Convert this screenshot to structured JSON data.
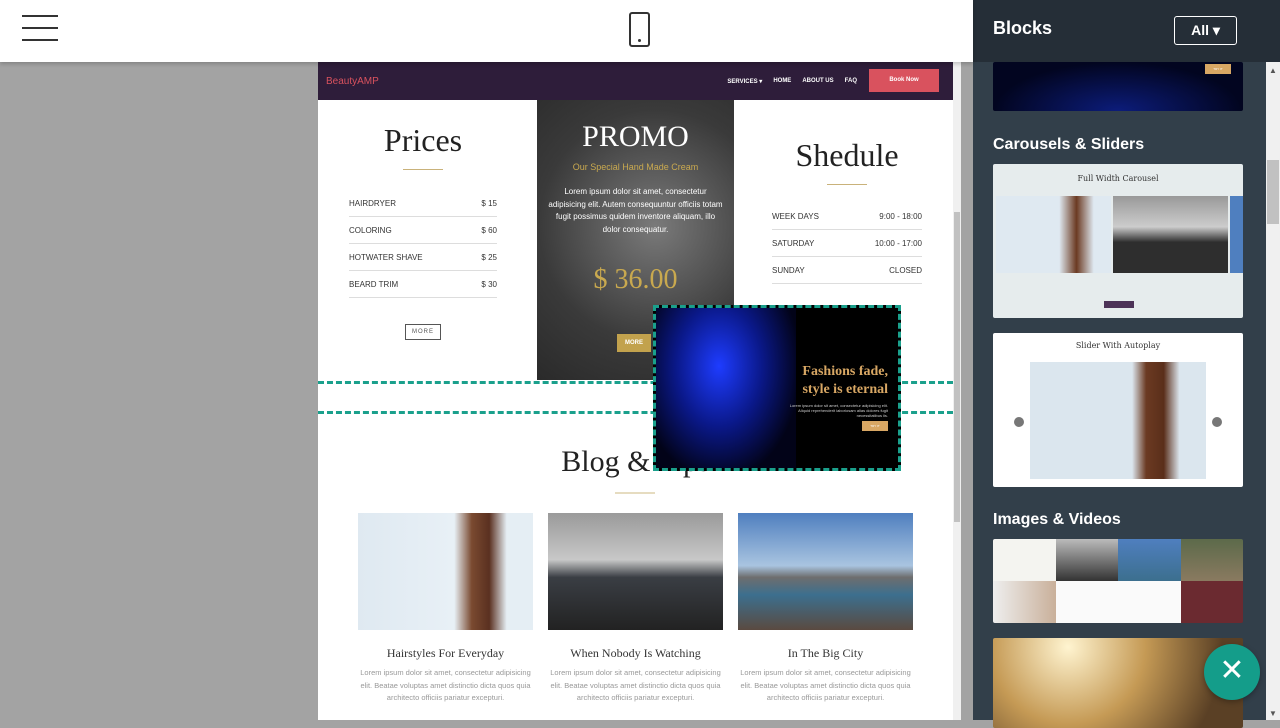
{
  "topbar": {
    "menu_icon": "hamburger-icon",
    "device_icon": "mobile-phone-icon"
  },
  "site": {
    "brand": "BeautyAMP",
    "nav": [
      "SERVICES ▾",
      "HOME",
      "ABOUT US",
      "FAQ"
    ],
    "book": "Book Now",
    "prices": {
      "title": "Prices",
      "items": [
        {
          "name": "HAIRDRYER",
          "price": "$ 15"
        },
        {
          "name": "COLORING",
          "price": "$ 60"
        },
        {
          "name": "HOTWATER SHAVE",
          "price": "$ 25"
        },
        {
          "name": "BEARD TRIM",
          "price": "$ 30"
        }
      ],
      "more": "MORE"
    },
    "promo": {
      "title": "PROMO",
      "subtitle": "Our Special Hand Made Cream",
      "body": "Lorem ipsum dolor sit amet, consectetur adipisicing elit. Autem consequuntur officiis totam fugit possimus quidem inventore aliquam, illo dolor consequatur.",
      "price": "$ 36.00",
      "more": "MORE"
    },
    "schedule": {
      "title": "Shedule",
      "items": [
        {
          "day": "WEEK DAYS",
          "time": "9:00 - 18:00"
        },
        {
          "day": "SATURDAY",
          "time": "10:00 - 17:00"
        },
        {
          "day": "SUNDAY",
          "time": "CLOSED"
        }
      ]
    },
    "blog": {
      "title": "Blog & Tips",
      "cards": [
        {
          "title": "Hairstyles For Everyday",
          "text": "Lorem ipsum dolor sit amet, consectetur adipisicing elit. Beatae voluptas amet distinctio dicta quos quia architecto officiis pariatur excepturi."
        },
        {
          "title": "When Nobody Is Watching",
          "text": "Lorem ipsum dolor sit amet, consectetur adipisicing elit. Beatae voluptas amet distinctio dicta quos quia architecto officiis pariatur excepturi."
        },
        {
          "title": "In The Big City",
          "text": "Lorem ipsum dolor sit amet, consectetur adipisicing elit. Beatae voluptas amet distinctio dicta quos quia architecto officiis pariatur excepturi."
        }
      ]
    }
  },
  "dragged": {
    "title_line1": "Fashions fade,",
    "title_line2": "style is eternal",
    "text": "Lorem ipsum dolor sit amet, consectetur adipisicing elit. Aliquid reprehenderit laboriosam alias dolores fugit necessitatibus iis.",
    "button": "TRY IT"
  },
  "sidebar": {
    "title": "Blocks",
    "filter": "All ▾",
    "sections": [
      "Carousels & Sliders",
      "Images & Videos"
    ],
    "thumbs": [
      "Full Width Carousel",
      "Slider With Autoplay"
    ],
    "top_thumb_button": "TRY IT"
  },
  "fab_icon": "close-icon",
  "colors": {
    "accent": "#149d8a",
    "nav": "#2e1d3a",
    "book": "#d9525e",
    "gold": "#c9a94f"
  }
}
